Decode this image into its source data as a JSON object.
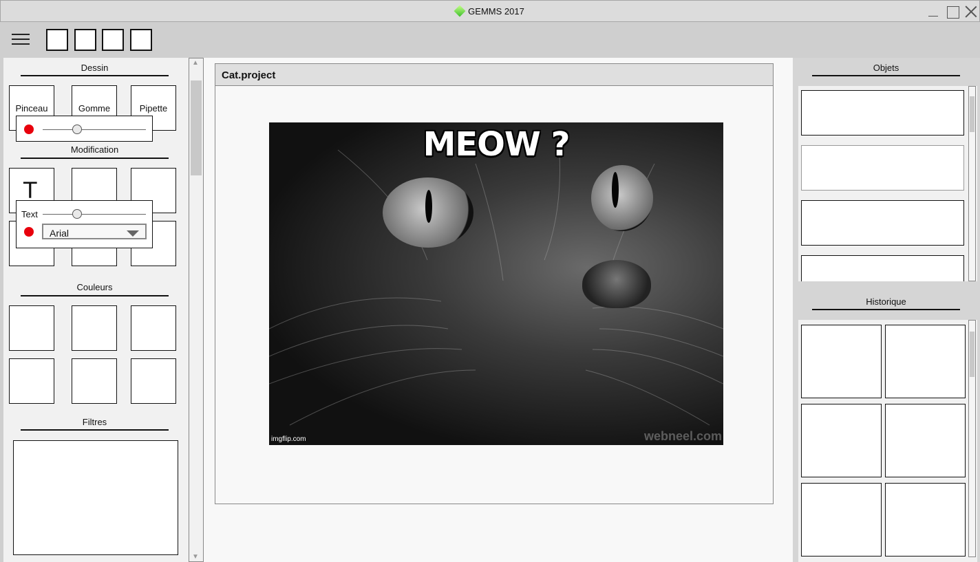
{
  "window": {
    "title": "GEMMS 2017",
    "controls": [
      "minimize",
      "maximize",
      "close"
    ]
  },
  "toolbar": {
    "menu_icon": "hamburger-icon",
    "quick_buttons": 4
  },
  "left_panel": {
    "dessin": {
      "title": "Dessin",
      "tools": [
        "Pinceau",
        "Gomme",
        "Pipette"
      ],
      "brush_popup": {
        "color": "#e8000c",
        "size_slider": 0.33
      }
    },
    "modification": {
      "title": "Modification",
      "text_tool_glyph": "T",
      "text_popup": {
        "label": "Text",
        "color": "#e8000c",
        "size_slider": 0.33,
        "font_selected": "Arial"
      }
    },
    "couleurs": {
      "title": "Couleurs"
    },
    "filtres": {
      "title": "Filtres"
    }
  },
  "project": {
    "title": "Cat.project",
    "image": {
      "caption": "MEOW ?",
      "watermark_left": "imgflip.com",
      "watermark_right": "webneel.com"
    }
  },
  "right_panel": {
    "objets": {
      "title": "Objets"
    },
    "historique": {
      "title": "Historique"
    }
  }
}
